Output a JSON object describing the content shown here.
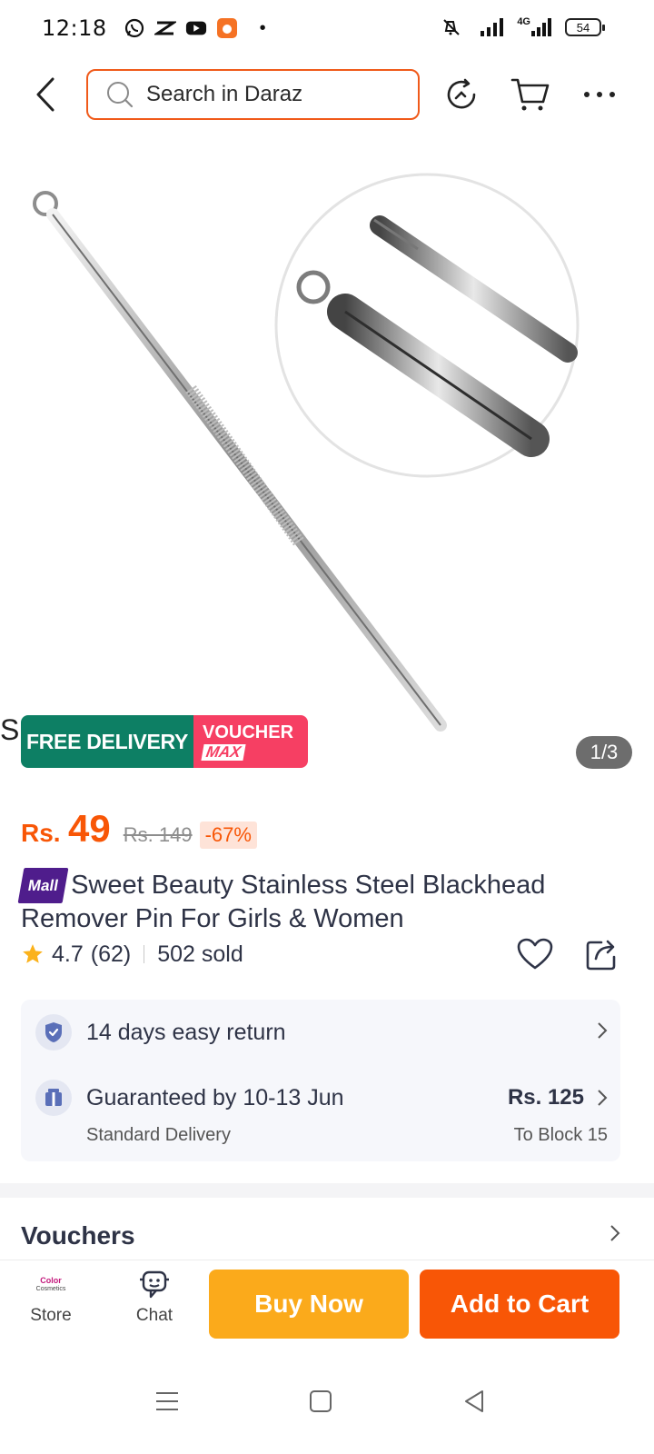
{
  "status_bar": {
    "time": "12:18",
    "app_icons": [
      "whatsapp-icon",
      "capcut-icon",
      "youtube-icon",
      "app-orange-icon"
    ],
    "network_label": "4G",
    "battery": "54"
  },
  "header": {
    "search_placeholder": "Search in Daraz",
    "icons": [
      "back-arrow-icon",
      "search-icon",
      "refresh-icon",
      "cart-icon",
      "more-icon"
    ]
  },
  "gallery": {
    "counter": "1/3",
    "left_peek_letter": "S",
    "promo_free": "FREE DELIVERY",
    "promo_voucher": "VOUCHER",
    "promo_max": "MAX"
  },
  "price": {
    "currency": "Rs.",
    "current": "49",
    "original": "Rs. 149",
    "discount": "-67%"
  },
  "product": {
    "mall_badge": "Mall",
    "title": "Sweet Beauty Stainless Steel Blackhead Remover Pin For Girls & Women"
  },
  "rating": {
    "score": "4.7",
    "count": "(62)",
    "sold": "502 sold"
  },
  "services": {
    "return_text": "14 days easy return",
    "delivery_text": "Guaranteed by 10-13 Jun",
    "delivery_type": "Standard Delivery",
    "delivery_fee": "Rs. 125",
    "delivery_location": "To Block 15"
  },
  "vouchers": {
    "title": "Vouchers"
  },
  "bottom_bar": {
    "store_label": "Store",
    "store_logo_text": "Color",
    "store_logo_sub": "Cosmetics",
    "chat_label": "Chat",
    "buy_now": "Buy Now",
    "add_to_cart": "Add to Cart"
  },
  "colors": {
    "brand_orange": "#f85606",
    "buy_now_yellow": "#fbaa1b",
    "free_delivery_green": "#0d7f64",
    "voucher_pink": "#f63f63",
    "mall_purple": "#4f1d8c"
  }
}
